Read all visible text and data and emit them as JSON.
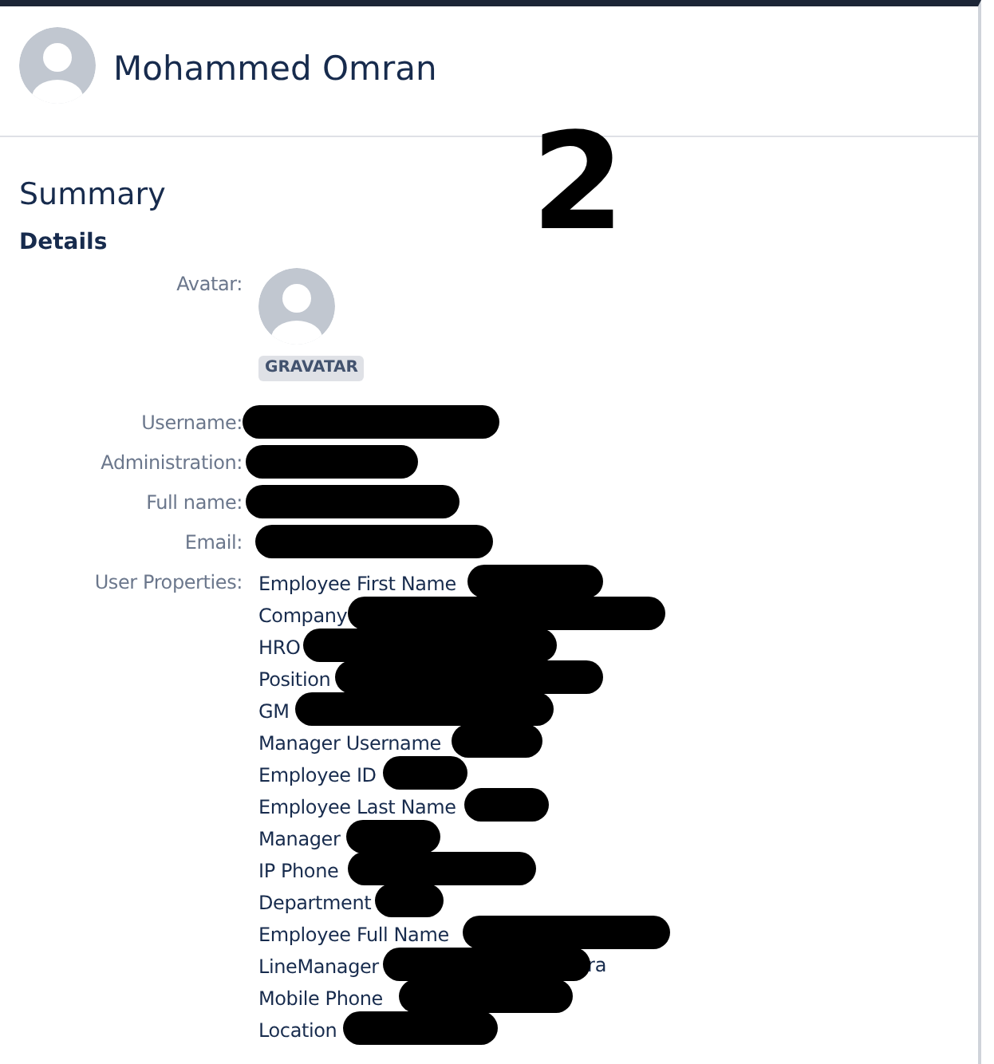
{
  "profile": {
    "name": "Mohammed Omran"
  },
  "annotation": {
    "text": "2"
  },
  "summary": {
    "title": "Summary",
    "section": "Details",
    "avatar_label": "Avatar:",
    "avatar_badge": "GRAVATAR"
  },
  "fields": [
    {
      "label": "Username:",
      "redacted": true
    },
    {
      "label": "Administration:",
      "redacted": true
    },
    {
      "label": "Full name:",
      "redacted": true
    },
    {
      "label": "Email:",
      "redacted": true
    }
  ],
  "user_properties": {
    "label": "User Properties:",
    "items": [
      {
        "text": "Employee First Name",
        "redacted": true
      },
      {
        "text": "Company",
        "redacted": true
      },
      {
        "text": "HRO",
        "redacted": true
      },
      {
        "text": "Position",
        "redacted": true
      },
      {
        "text": "GM",
        "redacted": true
      },
      {
        "text": "Manager Username",
        "redacted": true
      },
      {
        "text": "Employee ID",
        "redacted": true
      },
      {
        "text": "Employee Last Name",
        "redacted": true
      },
      {
        "text": "Manager",
        "redacted": true
      },
      {
        "text": "IP Phone",
        "redacted": true
      },
      {
        "text": "Department",
        "redacted": true
      },
      {
        "text": "Employee Full Name",
        "redacted": true
      },
      {
        "text": "LineManager",
        "redacted": true,
        "tail": "ra"
      },
      {
        "text": "Mobile Phone",
        "redacted": true
      },
      {
        "text": "Location",
        "redacted": true
      }
    ]
  }
}
